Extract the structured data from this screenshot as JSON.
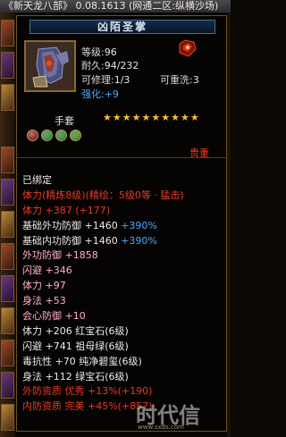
{
  "window": {
    "title": "《新天龙八部》 0.08.1613 (网通二区:纵横沙场)"
  },
  "item": {
    "name": "凶陌圣掌",
    "level_label": "等级:",
    "level": "96",
    "durability_label": "耐久:",
    "durability": "94/232",
    "repairable_label": "可修理:",
    "repairable": "1/3",
    "rewashable_label": "可重洗:",
    "rewashable": "3",
    "strengthen_label": "强化:",
    "strengthen": "+9",
    "type": "手套",
    "stars": 10,
    "sockets": [
      "#b02828",
      "#38a048",
      "#38a048",
      "#5aa030"
    ],
    "rank": "贵重",
    "gloves_icon": "gloves-icon",
    "gem_icon": "red-gem-icon"
  },
  "attributes": [
    {
      "text": "已绑定",
      "color": "white"
    },
    {
      "text": "体力(精炼8级)(精绘：5级0等 · 猛击)",
      "color": "red"
    },
    {
      "text": "体力 +387 (+177)",
      "color": "red"
    },
    {
      "text": "基础外功防御 +1460 ",
      "extra": "+390%",
      "color": "white"
    },
    {
      "text": "基础内功防御 +1460 ",
      "extra": "+390%",
      "color": "white"
    },
    {
      "text": "外功防御 +1858",
      "color": "pink"
    },
    {
      "text": "闪避 +346",
      "color": "pink"
    },
    {
      "text": "体力 +97",
      "color": "pink"
    },
    {
      "text": "身法 +53",
      "color": "pink"
    },
    {
      "text": "会心防御 +10",
      "color": "pink"
    },
    {
      "text": "体力 +206 红宝石(6级)",
      "color": "white"
    },
    {
      "text": "闪避 +741 祖母绿(6级)",
      "color": "white"
    },
    {
      "text": "毒抗性 +70 纯净碧玺(6级)",
      "color": "white"
    },
    {
      "text": "身法 +112 绿宝石(6级)",
      "color": "white"
    },
    {
      "text": "外防资质  优秀 +13%(+190)",
      "color": "red"
    },
    {
      "text": "内防资质  完美 +45%(+857)",
      "color": "red"
    }
  ],
  "watermark": {
    "text": "时代信",
    "sub": "www.sxds.com"
  },
  "colors": {
    "white": "#eaeaea",
    "red": "#e83a28",
    "pink": "#ffb0c8",
    "blue": "#48a8ff"
  }
}
